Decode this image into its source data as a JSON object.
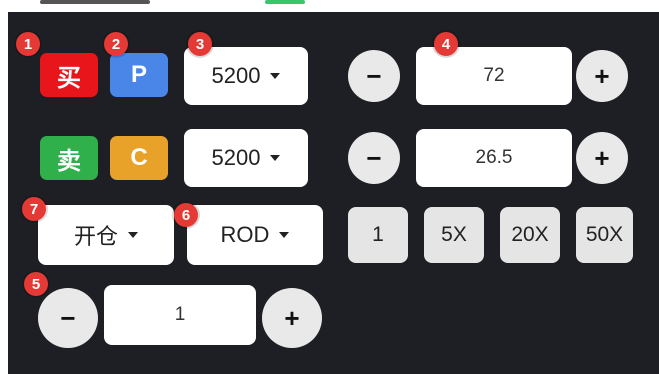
{
  "colors": {
    "buy": "#e8151b",
    "sell": "#2fb04a",
    "call": "#4a86e8",
    "put": "#e8a22a",
    "badge": "#e53935",
    "panel": "#1e1f24"
  },
  "row1": {
    "buy_label": "买",
    "call_label": "P",
    "strike": "5200",
    "price": "72",
    "minus": "−",
    "plus": "+"
  },
  "row2": {
    "sell_label": "卖",
    "put_label": "C",
    "strike": "5200",
    "price": "26.5",
    "minus": "−",
    "plus": "+"
  },
  "row3": {
    "open_close": "开仓",
    "order_type": "ROD",
    "multipliers": [
      "1",
      "5X",
      "20X",
      "50X"
    ]
  },
  "row4": {
    "quantity": "1",
    "minus": "−",
    "plus": "+"
  },
  "badges": [
    "1",
    "2",
    "3",
    "4",
    "5",
    "6",
    "7"
  ]
}
